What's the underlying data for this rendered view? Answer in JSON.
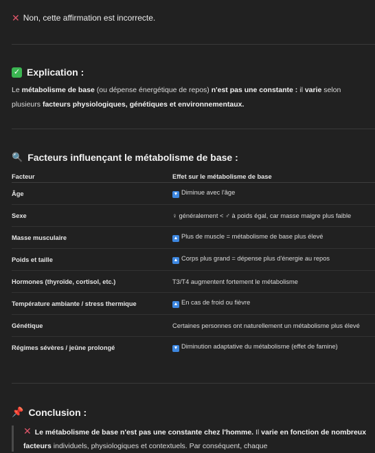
{
  "verdict": {
    "icon": "cross-mark-icon",
    "text": "Non, cette affirmation est incorrecte."
  },
  "explication": {
    "icon": "check-box-icon",
    "heading": "Explication :",
    "parts": [
      {
        "text": "Le ",
        "bold": false
      },
      {
        "text": "métabolisme de base",
        "bold": true
      },
      {
        "text": " (ou dépense énergétique de repos) ",
        "bold": false
      },
      {
        "text": "n'est pas une constante :",
        "bold": true
      },
      {
        "text": " il ",
        "bold": false
      },
      {
        "text": "varie",
        "bold": true
      },
      {
        "text": " selon plusieurs ",
        "bold": false
      },
      {
        "text": "facteurs physiologiques, génétiques et environnementaux.",
        "bold": true
      }
    ]
  },
  "facteurs": {
    "icon": "magnifying-glass-icon",
    "heading": "Facteurs influençant le métabolisme de base :",
    "columns": [
      "Facteur",
      "Effet sur le métabolisme de base"
    ],
    "rows": [
      {
        "facteur": "Âge",
        "icon": "down-arrow-icon",
        "effet": "Diminue avec l'âge"
      },
      {
        "facteur": "Sexe",
        "icon": "",
        "effet": "♀ généralement < ♂ à poids égal, car masse maigre plus faible"
      },
      {
        "facteur": "Masse musculaire",
        "icon": "up-arrow-icon",
        "effet": "Plus de muscle = métabolisme de base plus élevé"
      },
      {
        "facteur": "Poids et taille",
        "icon": "up-arrow-icon",
        "effet": "Corps plus grand = dépense plus d'énergie au repos"
      },
      {
        "facteur": "Hormones (thyroïde, cortisol, etc.)",
        "icon": "",
        "effet": "T3/T4 augmentent fortement le métabolisme"
      },
      {
        "facteur": "Température ambiante / stress thermique",
        "icon": "up-arrow-icon",
        "effet": "En cas de froid ou fièvre"
      },
      {
        "facteur": "Génétique",
        "icon": "",
        "effet": "Certaines personnes ont naturellement un métabolisme plus élevé"
      },
      {
        "facteur": "Régimes sévères / jeûne prolongé",
        "icon": "down-arrow-icon",
        "effet": "Diminution adaptative du métabolisme (effet de famine)"
      }
    ]
  },
  "conclusion": {
    "icon": "pushpin-icon",
    "heading": "Conclusion :",
    "quote_icon": "cross-mark-icon",
    "parts": [
      {
        "text": "Le métabolisme de base n'est pas une constante chez l'homme.",
        "bold": true
      },
      {
        "text": " Il ",
        "bold": false
      },
      {
        "text": "varie en fonction de nombreux facteurs",
        "bold": true
      },
      {
        "text": " individuels, physiologiques et contextuels. Par conséquent, chaque",
        "bold": false
      }
    ]
  },
  "colors": {
    "background": "#212121",
    "text": "#ececec",
    "accent_arrow": "#3d87e0",
    "check": "#3bb552",
    "cross": "#e0566a"
  }
}
